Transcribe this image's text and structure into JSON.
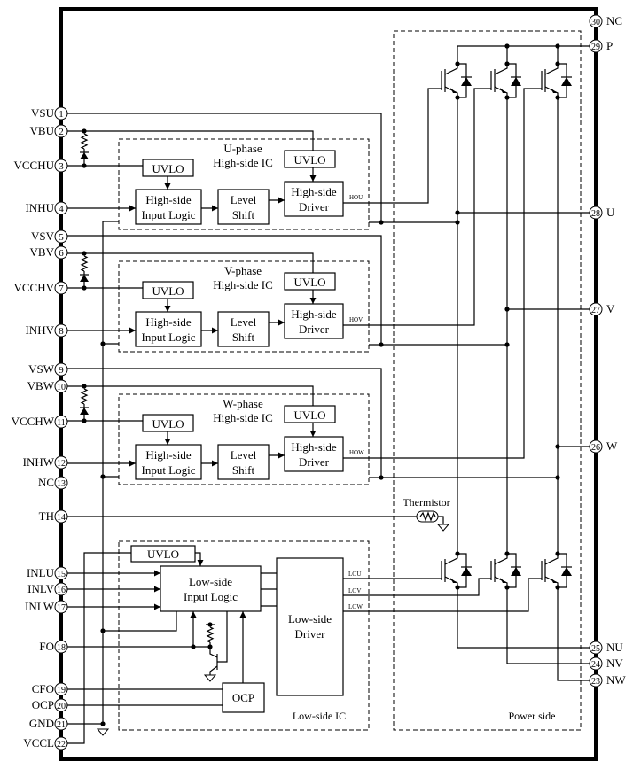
{
  "pins_left": [
    {
      "num": "1",
      "label": "VSU"
    },
    {
      "num": "2",
      "label": "VBU"
    },
    {
      "num": "3",
      "label": "VCCHU"
    },
    {
      "num": "4",
      "label": "INHU"
    },
    {
      "num": "5",
      "label": "VSV"
    },
    {
      "num": "6",
      "label": "VBV"
    },
    {
      "num": "7",
      "label": "VCCHV"
    },
    {
      "num": "8",
      "label": "INHV"
    },
    {
      "num": "9",
      "label": "VSW"
    },
    {
      "num": "10",
      "label": "VBW"
    },
    {
      "num": "11",
      "label": "VCCHW"
    },
    {
      "num": "12",
      "label": "INHW"
    },
    {
      "num": "13",
      "label": "NC"
    },
    {
      "num": "14",
      "label": "TH"
    },
    {
      "num": "15",
      "label": "INLU"
    },
    {
      "num": "16",
      "label": "INLV"
    },
    {
      "num": "17",
      "label": "INLW"
    },
    {
      "num": "18",
      "label": "FO"
    },
    {
      "num": "19",
      "label": "CFO"
    },
    {
      "num": "20",
      "label": "OCP"
    },
    {
      "num": "21",
      "label": "GND"
    },
    {
      "num": "22",
      "label": "VCCL"
    }
  ],
  "pins_right": [
    {
      "num": "30",
      "label": "NC"
    },
    {
      "num": "29",
      "label": "P"
    },
    {
      "num": "28",
      "label": "U"
    },
    {
      "num": "27",
      "label": "V"
    },
    {
      "num": "26",
      "label": "W"
    },
    {
      "num": "25",
      "label": "NU"
    },
    {
      "num": "24",
      "label": "NV"
    },
    {
      "num": "23",
      "label": "NW"
    }
  ],
  "phases": [
    {
      "title": "U-phase",
      "subtitle": "High-side IC",
      "uvlo_vcc": "UVLO",
      "uvlo_vb": "UVLO",
      "input_logic": [
        "High-side",
        "Input Logic"
      ],
      "level_shift": [
        "Level",
        "Shift"
      ],
      "driver": [
        "High-side",
        "Driver"
      ],
      "output": "HOU"
    },
    {
      "title": "V-phase",
      "subtitle": "High-side IC",
      "uvlo_vcc": "UVLO",
      "uvlo_vb": "UVLO",
      "input_logic": [
        "High-side",
        "Input Logic"
      ],
      "level_shift": [
        "Level",
        "Shift"
      ],
      "driver": [
        "High-side",
        "Driver"
      ],
      "output": "HOV"
    },
    {
      "title": "W-phase",
      "subtitle": "High-side IC",
      "uvlo_vcc": "UVLO",
      "uvlo_vb": "UVLO",
      "input_logic": [
        "High-side",
        "Input Logic"
      ],
      "level_shift": [
        "Level",
        "Shift"
      ],
      "driver": [
        "High-side",
        "Driver"
      ],
      "output": "HOW"
    }
  ],
  "low_side": {
    "title": "Low-side IC",
    "uvlo": "UVLO",
    "input_logic": [
      "Low-side",
      "Input Logic"
    ],
    "driver": [
      "Low-side",
      "Driver"
    ],
    "ocp": "OCP",
    "outputs": [
      "LOU",
      "LOV",
      "LOW"
    ]
  },
  "power_side": {
    "title": "Power side"
  },
  "thermistor": {
    "label": "Thermistor"
  }
}
